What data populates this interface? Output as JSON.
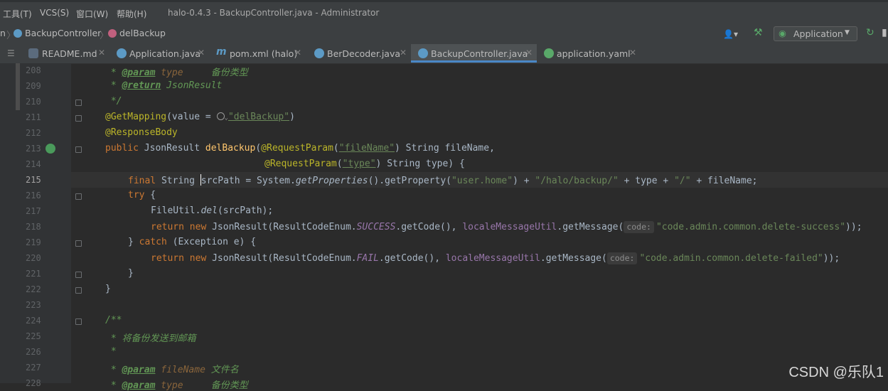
{
  "menubar": {
    "items": [
      "工具(T)",
      "VCS(S)",
      "窗口(W)",
      "帮助(H)"
    ],
    "window_title": "halo-0.4.3 - BackupController.java - Administrator"
  },
  "breadcrumb": {
    "partial": "n",
    "items": [
      "BackupController",
      "delBackup"
    ]
  },
  "toolbar": {
    "run_config": "Application"
  },
  "tabs": [
    {
      "label": "README.md",
      "icon": "markdown-icon"
    },
    {
      "label": "Application.java",
      "icon": "spring-class-icon"
    },
    {
      "label": "pom.xml (halo)",
      "icon": "maven-icon"
    },
    {
      "label": "BerDecoder.java",
      "icon": "class-icon"
    },
    {
      "label": "BackupController.java",
      "icon": "class-icon",
      "active": true
    },
    {
      "label": "application.yaml",
      "icon": "spring-config-icon"
    }
  ],
  "editor": {
    "current_line": 215,
    "lines": {
      "l208": {
        "num": "208",
        "p1": " * ",
        "tag": "@param",
        "sp": " ",
        "v": "type",
        "rest": "     备份类型"
      },
      "l209": {
        "num": "209",
        "p1": " * ",
        "tag": "@return",
        "rest": " JsonResult"
      },
      "l210": {
        "num": "210",
        "text": " */"
      },
      "l211": {
        "num": "211",
        "an": "@GetMapping",
        "a": "(value = ",
        "str": "\"delBackup\"",
        "b": ")"
      },
      "l212": {
        "num": "212",
        "an": "@ResponseBody"
      },
      "l213": {
        "num": "213",
        "kw": "public",
        "a": " JsonResult ",
        "fn": "delBackup",
        "b": "(",
        "an": "@RequestParam",
        "c": "(",
        "str": "\"fileName\"",
        "d": ") String fileName,"
      },
      "l214": {
        "num": "214",
        "an": "@RequestParam",
        "c": "(",
        "str": "\"type\"",
        "d": ") String type) {"
      },
      "l215": {
        "num": "215",
        "kw": "final",
        "a": " String ",
        "b": "srcPath = System.",
        "it": "getProperties",
        "c": "().getProperty(",
        "s1": "\"user.home\"",
        "d": ") + ",
        "s2": "\"/halo/backup/\"",
        "e": " + type + ",
        "s3": "\"/\"",
        "f": " + fileName;"
      },
      "l216": {
        "num": "216",
        "kw": "try",
        "a": " {"
      },
      "l217": {
        "num": "217",
        "a": "FileUtil.",
        "it": "del",
        "b": "(srcPath);"
      },
      "l218": {
        "num": "218",
        "kw": "return new",
        "a": " JsonResult(ResultCodeEnum.",
        "fld": "SUCCESS",
        "b": ".getCode(), ",
        "lm": "localeMessageUtil",
        "c": ".getMessage(",
        "hint": "code:",
        "str": "\"code.admin.common.delete-success\"",
        "d": "));"
      },
      "l219": {
        "num": "219",
        "a": "} ",
        "kw": "catch",
        "b": " (Exception e) {"
      },
      "l220": {
        "num": "220",
        "kw": "return new",
        "a": " JsonResult(ResultCodeEnum.",
        "fld": "FAIL",
        "b": ".getCode(), ",
        "lm": "localeMessageUtil",
        "c": ".getMessage(",
        "hint": "code:",
        "str": "\"code.admin.common.delete-failed\"",
        "d": "));"
      },
      "l221": {
        "num": "221",
        "text": "}"
      },
      "l222": {
        "num": "222",
        "text": "}"
      },
      "l223": {
        "num": "223"
      },
      "l224": {
        "num": "224",
        "text": "/**"
      },
      "l225": {
        "num": "225",
        "text": " * 将备份发送到邮箱"
      },
      "l226": {
        "num": "226",
        "text": " *"
      },
      "l227": {
        "num": "227",
        "p1": " * ",
        "tag": "@param",
        "sp": " ",
        "v": "fileName",
        "rest": " 文件名"
      },
      "l228": {
        "num": "228",
        "p1": " * ",
        "tag": "@param",
        "sp": " ",
        "v": "type",
        "rest": "     备份类型"
      }
    }
  },
  "watermark": "CSDN @乐队1"
}
